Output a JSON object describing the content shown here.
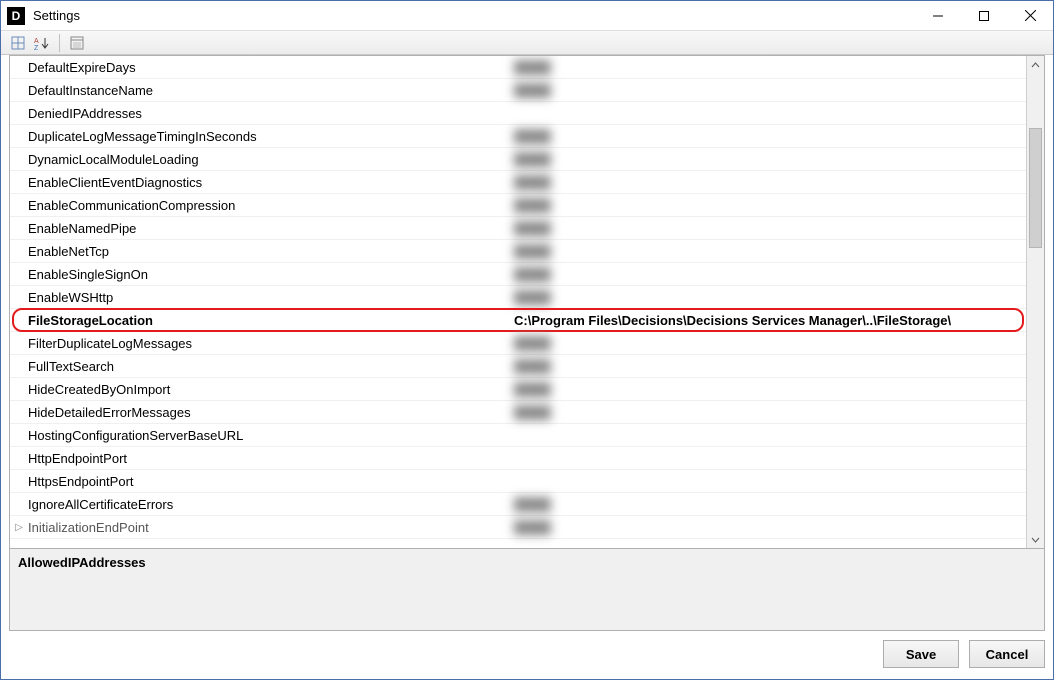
{
  "window": {
    "title": "Settings"
  },
  "toolbar": {
    "btn_categorize": "categorize-icon",
    "btn_sort": "sort-az-icon",
    "btn_pages": "property-pages-icon"
  },
  "rows": [
    {
      "label": "DefaultExpireDays",
      "value": "",
      "blur": true
    },
    {
      "label": "DefaultInstanceName",
      "value": "",
      "blur": true
    },
    {
      "label": "DeniedIPAddresses",
      "value": "",
      "blur": false
    },
    {
      "label": "DuplicateLogMessageTimingInSeconds",
      "value": "",
      "blur": true
    },
    {
      "label": "DynamicLocalModuleLoading",
      "value": "",
      "blur": true
    },
    {
      "label": "EnableClientEventDiagnostics",
      "value": "",
      "blur": true
    },
    {
      "label": "EnableCommunicationCompression",
      "value": "",
      "blur": true
    },
    {
      "label": "EnableNamedPipe",
      "value": "",
      "blur": true
    },
    {
      "label": "EnableNetTcp",
      "value": "",
      "blur": true
    },
    {
      "label": "EnableSingleSignOn",
      "value": "",
      "blur": true
    },
    {
      "label": "EnableWSHttp",
      "value": "",
      "blur": true
    },
    {
      "label": "FileStorageLocation",
      "value": "C:\\Program Files\\Decisions\\Decisions Services Manager\\..\\FileStorage\\",
      "blur": false,
      "highlight": true
    },
    {
      "label": "FilterDuplicateLogMessages",
      "value": "",
      "blur": true
    },
    {
      "label": "FullTextSearch",
      "value": "",
      "blur": true
    },
    {
      "label": "HideCreatedByOnImport",
      "value": "",
      "blur": true
    },
    {
      "label": "HideDetailedErrorMessages",
      "value": "",
      "blur": true
    },
    {
      "label": "HostingConfigurationServerBaseURL",
      "value": "",
      "blur": false
    },
    {
      "label": "HttpEndpointPort",
      "value": "",
      "blur": false
    },
    {
      "label": "HttpsEndpointPort",
      "value": "",
      "blur": false
    },
    {
      "label": "IgnoreAllCertificateErrors",
      "value": "",
      "blur": true
    },
    {
      "label": "InitializationEndPoint",
      "value": "",
      "blur": true,
      "expand": true
    }
  ],
  "description": {
    "title": "AllowedIPAddresses",
    "body": ""
  },
  "buttons": {
    "save": "Save",
    "cancel": "Cancel"
  }
}
